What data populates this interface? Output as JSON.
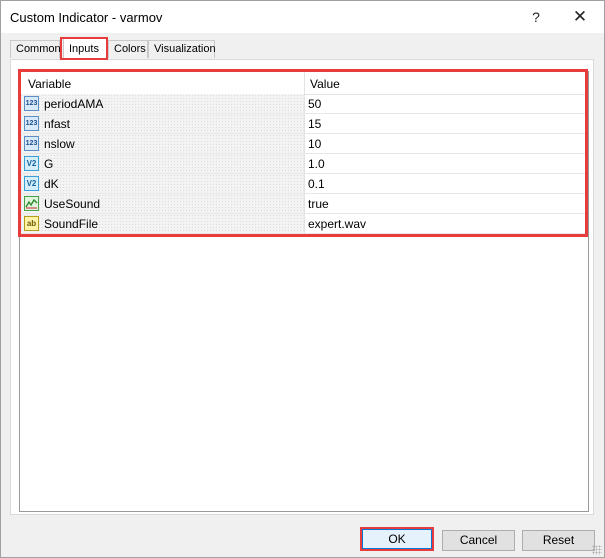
{
  "window": {
    "title": "Custom Indicator - varmov",
    "help_label": "?",
    "close_label": "✕"
  },
  "tabs": [
    {
      "label": "Common"
    },
    {
      "label": "Inputs"
    },
    {
      "label": "Colors"
    },
    {
      "label": "Visualization"
    }
  ],
  "grid": {
    "headers": {
      "variable": "Variable",
      "value": "Value"
    },
    "rows": [
      {
        "icon": "integer-icon",
        "icon_text": "123",
        "variable": "periodAMA",
        "value": "50"
      },
      {
        "icon": "integer-icon",
        "icon_text": "123",
        "variable": "nfast",
        "value": "15"
      },
      {
        "icon": "integer-icon",
        "icon_text": "123",
        "variable": "nslow",
        "value": "10"
      },
      {
        "icon": "double-icon",
        "icon_text": "V2",
        "variable": "G",
        "value": "1.0"
      },
      {
        "icon": "double-icon",
        "icon_text": "V2",
        "variable": "dK",
        "value": "0.1"
      },
      {
        "icon": "boolean-icon",
        "icon_text": "",
        "variable": "UseSound",
        "value": "true"
      },
      {
        "icon": "string-icon",
        "icon_text": "ab",
        "variable": "SoundFile",
        "value": "expert.wav"
      }
    ]
  },
  "buttons": {
    "ok": "OK",
    "cancel": "Cancel",
    "reset": "Reset"
  },
  "colors": {
    "highlight": "#e83b3b",
    "focus": "#0078d7"
  }
}
